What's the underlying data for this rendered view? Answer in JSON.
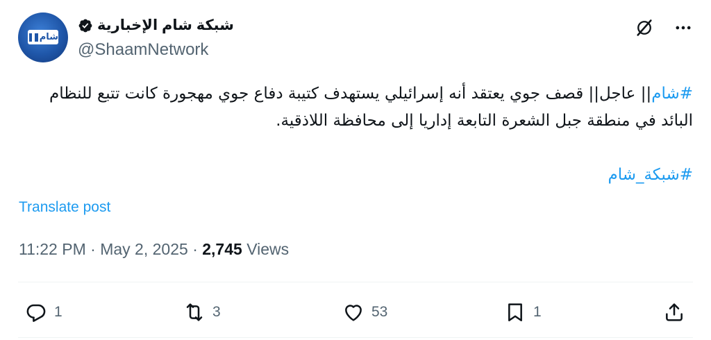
{
  "author": {
    "display_name": "شبكة شام الإخبارية",
    "handle": "@ShaamNetwork",
    "avatar_text": "شام",
    "verified": true,
    "verified_color": "#0f1419"
  },
  "top_icons": [
    "grok-icon",
    "more-icon"
  ],
  "tweet": {
    "hashtag_1": "#شام",
    "text": "|| عاجل|| قصف جوي يعتقد أنه إسرائيلي يستهدف كتيبة دفاع جوي مهجورة كانت تتبع للنظام البائد في منطقة جبل الشعرة التابعة إداريا إلى محافظة اللاذقية.",
    "hashtag_2": "#شبكة_شام"
  },
  "translate_label": "Translate post",
  "meta": {
    "time": "11:22 PM",
    "separator": "·",
    "date": "May 2, 2025",
    "views_count": "2,745",
    "views_label": "Views"
  },
  "actions": {
    "reply": {
      "icon": "reply-icon",
      "count": "1"
    },
    "repost": {
      "icon": "repost-icon",
      "count": "3"
    },
    "like": {
      "icon": "heart-icon",
      "count": "53"
    },
    "bookmark": {
      "icon": "bookmark-icon",
      "count": "1"
    },
    "share": {
      "icon": "share-icon"
    }
  },
  "colors": {
    "link": "#1d9bf0",
    "secondary_text": "#536471",
    "primary_text": "#0f1419"
  }
}
